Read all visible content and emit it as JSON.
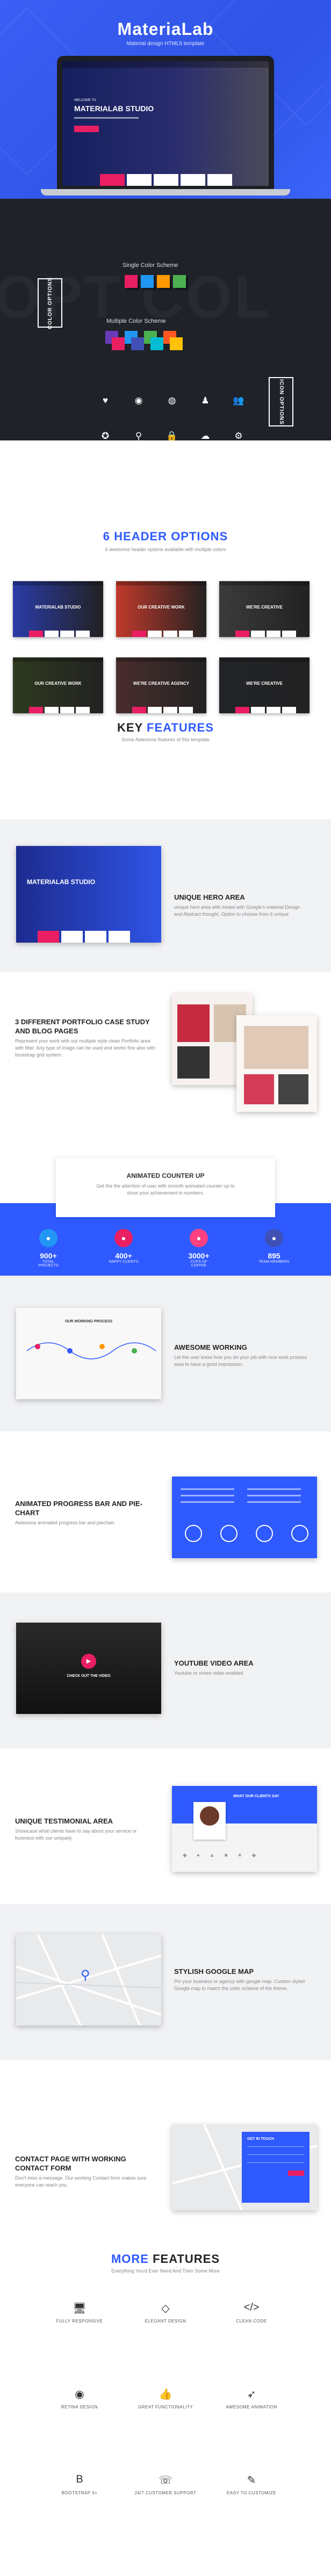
{
  "hero": {
    "title": "MateriaLab",
    "subtitle": "Material design HTML5 template",
    "screen_small": "WELCOME TO",
    "screen_title": "MATERIALAB STUDIO"
  },
  "color_section": {
    "vertical_left": "COLOR OPTIONS",
    "vertical_right": "ICON OPTIONS",
    "single_label": "Single Color Scheme",
    "multiple_label": "Multiple Color Scheme",
    "bg_text": "OPT COL",
    "single_colors": [
      "#e91e63",
      "#2196f3",
      "#ff9800",
      "#4caf50"
    ],
    "multi_rows": [
      [
        "#673ab7",
        "#e91e63"
      ],
      [
        "#2196f3",
        "#3f51b5"
      ],
      [
        "#4caf50",
        "#00bcd4"
      ],
      [
        "#ff5722",
        "#ffc107"
      ]
    ],
    "icons": [
      {
        "name": "heart-icon",
        "glyph": "♥"
      },
      {
        "name": "soccer-icon",
        "glyph": "◉"
      },
      {
        "name": "globe-icon",
        "glyph": "◍"
      },
      {
        "name": "user-add-icon",
        "glyph": "♟"
      },
      {
        "name": "users-icon",
        "glyph": "👥"
      },
      {
        "name": "compass-icon",
        "glyph": "✪"
      },
      {
        "name": "map-pin-icon",
        "glyph": "⚲"
      },
      {
        "name": "lock-icon",
        "glyph": "🔒"
      },
      {
        "name": "cloud-icon",
        "glyph": "☁"
      },
      {
        "name": "settings-icon",
        "glyph": "⚙"
      }
    ]
  },
  "headers": {
    "title_number": "6",
    "title_text": "HEADER OPTIONS",
    "subtitle": "6 awesome header options available with multiple colors",
    "thumbs": [
      {
        "title": "MATERIALAB STUDIO",
        "bg": "#2a3ba8"
      },
      {
        "title": "OUR CREATIVE WORK",
        "bg": "#c0392b"
      },
      {
        "title": "WE'RE CREATIVE",
        "bg": "#3b3b3b"
      },
      {
        "title": "OUR CREATIVE WORK",
        "bg": "#2e3a1f"
      },
      {
        "title": "WE'RE CREATIVE AGENCY",
        "bg": "#4a2d2d"
      },
      {
        "title": "WE'RE CREATIVE",
        "bg": "#222428"
      }
    ]
  },
  "key": {
    "title_a": "KEY",
    "title_b": "FEATURES",
    "subtitle": "Some Awesome features of this template"
  },
  "features": [
    {
      "title": "UNIQUE HERO AREA",
      "desc": "unique hero area with mixed with Google's material Design and Abstract thought. Option to choose from 6 unique"
    },
    {
      "title": "3 DIFFERENT PORTFOLIO CASE STUDY AND BLOG PAGES",
      "desc": "Represent your work with our multiple style clean Portfolio area with filter. Any type of image can be used and works fine also with bootstrap grid system."
    },
    {
      "title": "ANIMATED COUNTER UP",
      "desc": "Get the the attention of user with smooth animated counter up to show your achievement in numbers."
    },
    {
      "title": "AWESOME WORKING",
      "desc": "Let the user know how you do your job with nice work process area to have a good impression."
    },
    {
      "title": "ANIMATED PROGRESS BAR AND PIE-CHART",
      "desc": "Awesome animated progress bar and piechart."
    },
    {
      "title": "YOUTUBE VIDEO AREA",
      "desc": "Youtube or vimeo video enabled"
    },
    {
      "title": "UNIQUE TESTIMONIAL AREA",
      "desc": "Showcase what clients have to say about your service or business with our uniquely"
    },
    {
      "title": "STYLISH GOOGLE MAP",
      "desc": "Pin your business or agency with google map. Custom styled Google map to match the color scheme of the theme."
    },
    {
      "title": "CONTACT PAGE WITH WORKING CONTACT FORM",
      "desc": "Don't miss a message. Our working Contact form makes sure everyone can reach you."
    }
  ],
  "counters": [
    {
      "num": "900+",
      "label": "TOTAL PROJECTS",
      "color": "#2196f3"
    },
    {
      "num": "400+",
      "label": "HAPPY CLIENTS",
      "color": "#e91e63"
    },
    {
      "num": "3000+",
      "label": "CUPS OF COFFEE",
      "color": "#ff4081"
    },
    {
      "num": "895",
      "label": "TEAM MEMBERS",
      "color": "#3f51b5"
    }
  ],
  "process_title": "OUR WORKING PROCESS",
  "video_label": "CHECK OUT THE VIDEO",
  "testimonial_label": "WHAT OUR CLIENTS SAY",
  "contact_label": "GET IN TOUCH",
  "more": {
    "title_a": "MORE",
    "title_b": "FEATURES",
    "subtitle": "Everything You'd Ever Need And Then Some More",
    "items": [
      {
        "label": "FULLY RESPONSIVE",
        "icon_name": "monitor-icon",
        "glyph": "🖥"
      },
      {
        "label": "ELEGANT DESIGN",
        "icon_name": "diamond-icon",
        "glyph": "◇"
      },
      {
        "label": "CLEAN CODE",
        "icon_name": "code-icon",
        "glyph": "</>"
      },
      {
        "label": "RETINA DESIGN",
        "icon_name": "eye-icon",
        "glyph": "◉"
      },
      {
        "label": "GREAT FUNCTIONALITY",
        "icon_name": "thumb-icon",
        "glyph": "👍"
      },
      {
        "label": "AWESOME ANIMATION",
        "icon_name": "rocket-icon",
        "glyph": "➶"
      },
      {
        "label": "BOOTSTRAP 3+",
        "icon_name": "bootstrap-icon",
        "glyph": "B"
      },
      {
        "label": "24/7 CUSTOMER SUPPORT",
        "icon_name": "support-icon",
        "glyph": "☏"
      },
      {
        "label": "EASY TO CUSTOMIZE",
        "icon_name": "wand-icon",
        "glyph": "✎"
      }
    ]
  }
}
